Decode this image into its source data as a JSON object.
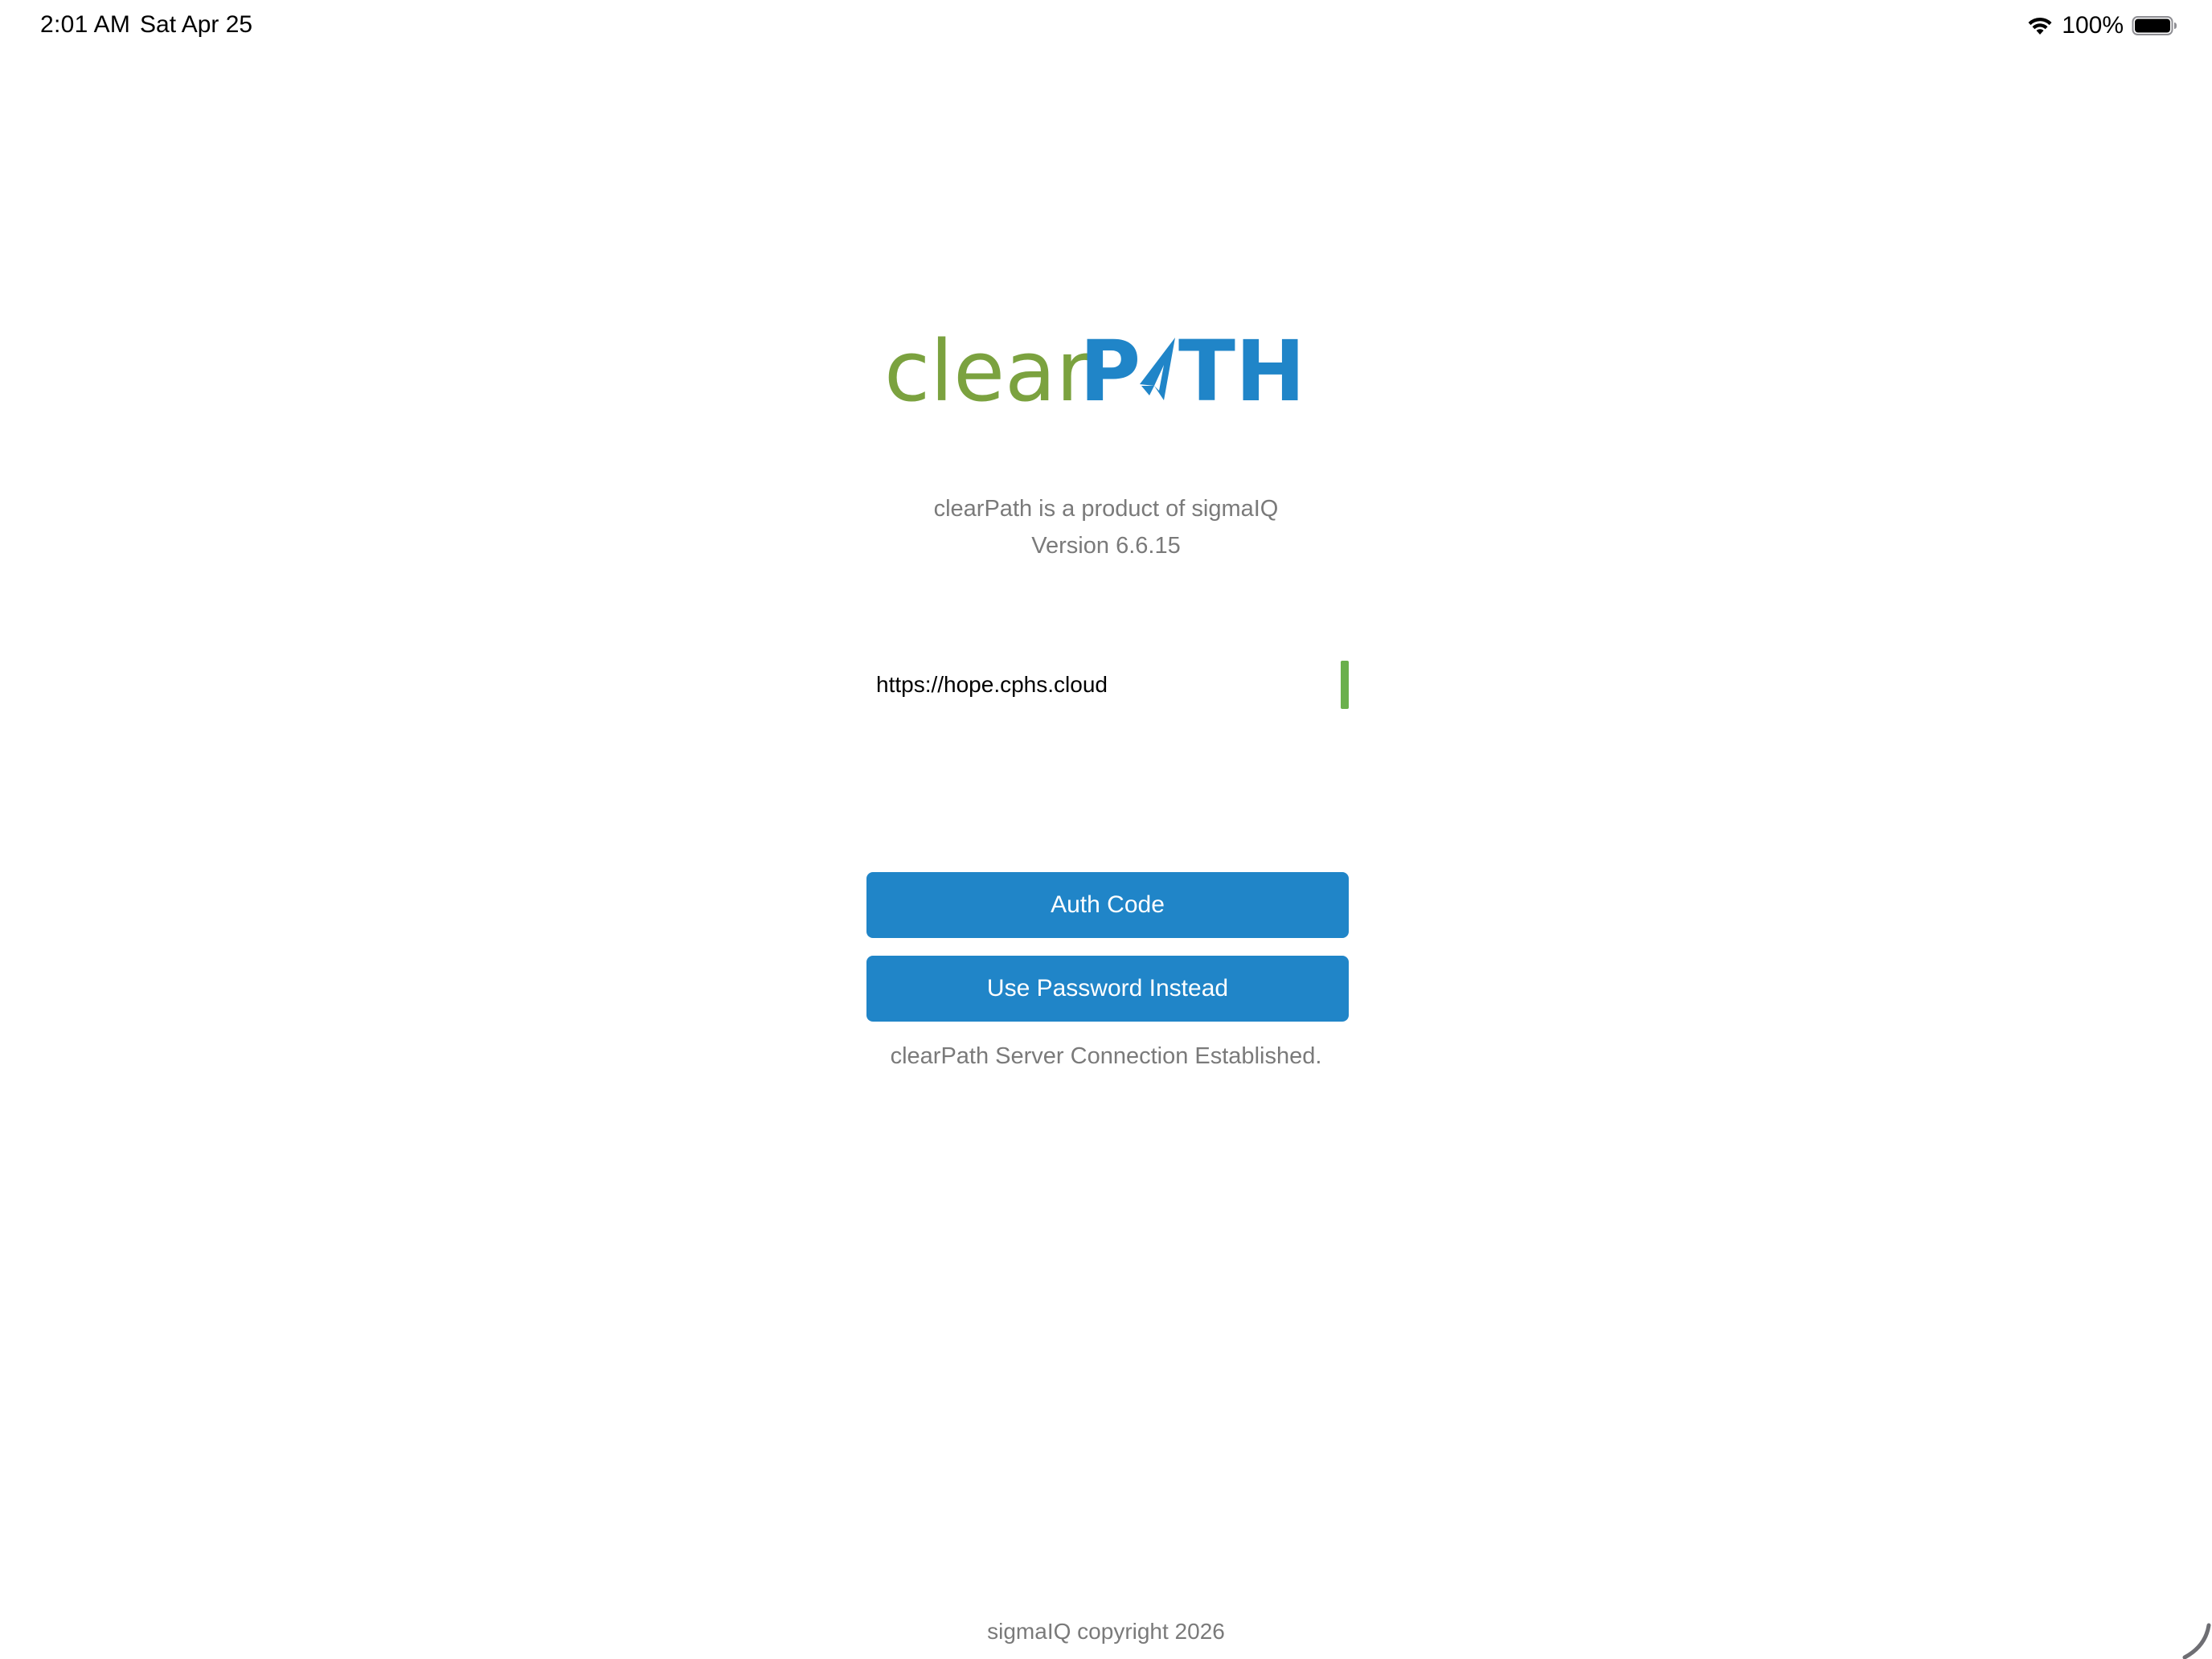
{
  "status_bar": {
    "time": "2:01 AM",
    "date": "Sat Apr 25",
    "battery_percent": "100%",
    "wifi_icon": "wifi-icon",
    "battery_icon": "battery-full-icon"
  },
  "logo": {
    "text_left": "clear",
    "text_right": "PATH",
    "color_left": "#7ba23f",
    "color_right": "#2085c8"
  },
  "product": {
    "line": "clearPath is a product of sigmaIQ",
    "version": "Version 6.6.15"
  },
  "server": {
    "value": "https://hope.cphs.cloud",
    "indicator_color": "#6ab04c"
  },
  "buttons": {
    "auth_code": "Auth Code",
    "use_password": "Use Password Instead",
    "color": "#2085c8"
  },
  "status_message": "clearPath Server Connection Established.",
  "footer": {
    "copyright": "sigmaIQ copyright 2026"
  }
}
